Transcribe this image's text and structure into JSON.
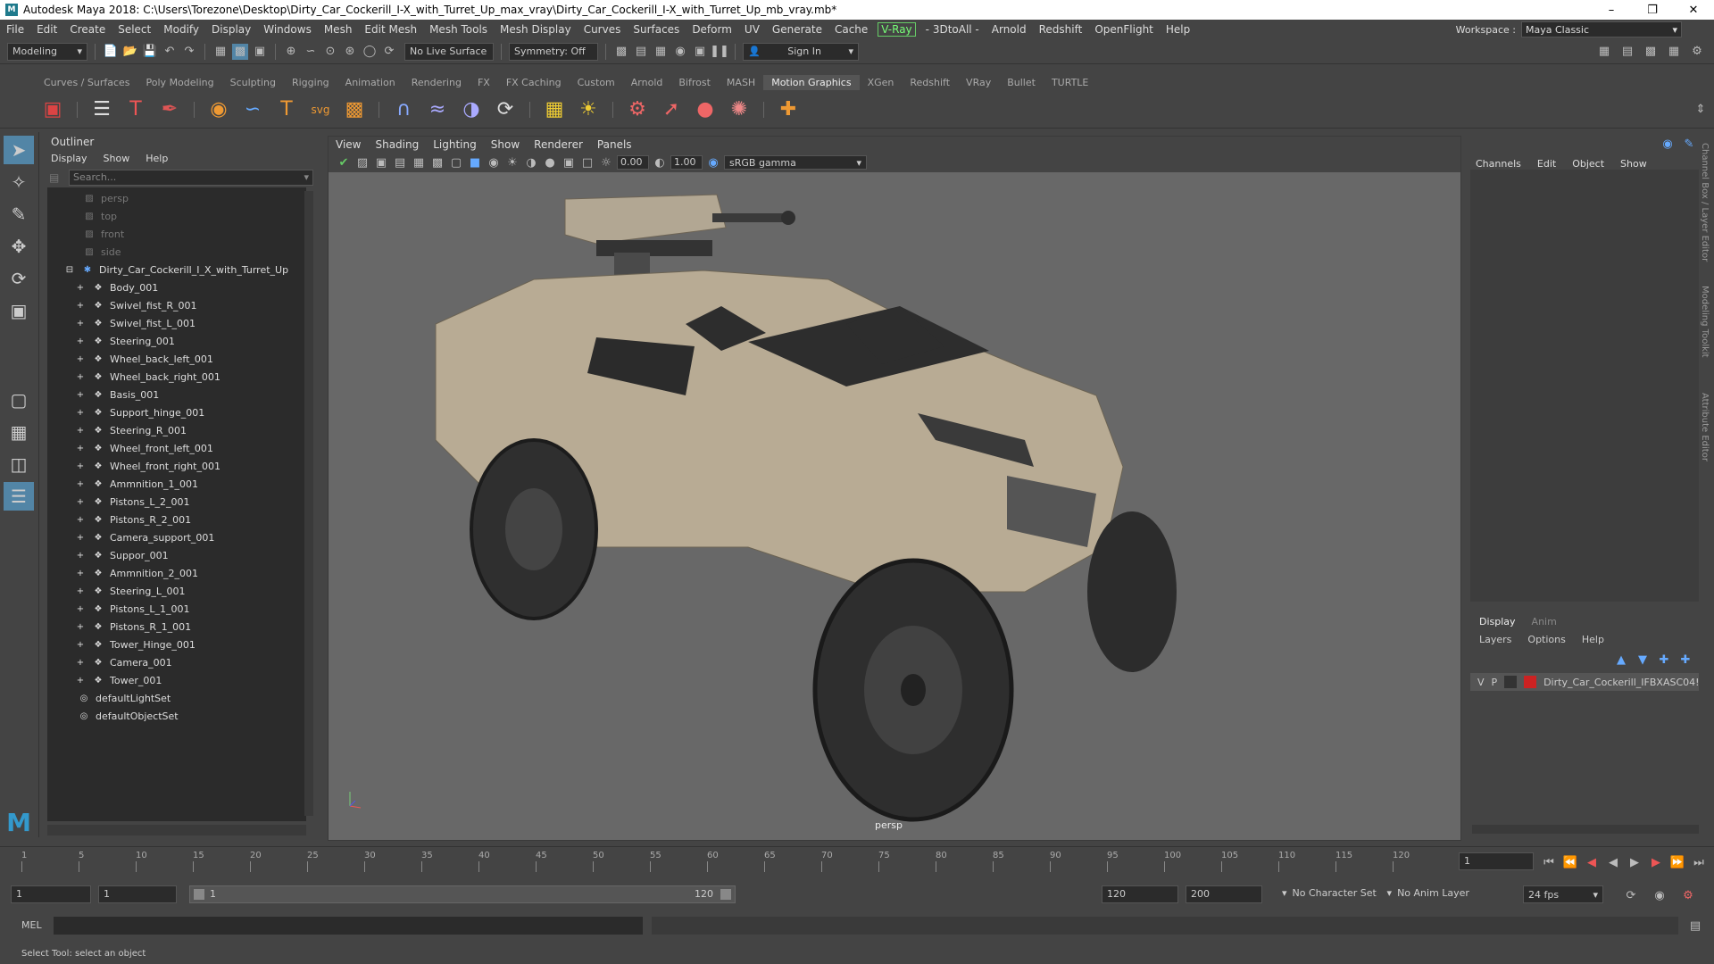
{
  "title": "Autodesk Maya 2018: C:\\Users\\Torezone\\Desktop\\Dirty_Car_Cockerill_I-X_with_Turret_Up_max_vray\\Dirty_Car_Cockerill_I-X_with_Turret_Up_mb_vray.mb*",
  "menu": [
    "File",
    "Edit",
    "Create",
    "Select",
    "Modify",
    "Display",
    "Windows",
    "Mesh",
    "Edit Mesh",
    "Mesh Tools",
    "Mesh Display",
    "Curves",
    "Surfaces",
    "Deform",
    "UV",
    "Generate",
    "Cache"
  ],
  "menu2": [
    "- 3DtoAll -",
    "Arnold",
    "Redshift",
    "OpenFlight",
    "Help"
  ],
  "vray": "V-Ray",
  "workspace": {
    "label": "Workspace :",
    "value": "Maya Classic"
  },
  "status": {
    "mode": "Modeling",
    "live": "No Live Surface",
    "symmetry": "Symmetry: Off",
    "signin": "Sign In"
  },
  "shelf_tabs": [
    "Curves / Surfaces",
    "Poly Modeling",
    "Sculpting",
    "Rigging",
    "Animation",
    "Rendering",
    "FX",
    "FX Caching",
    "Custom",
    "Arnold",
    "Bifrost",
    "MASH",
    "Motion Graphics",
    "XGen",
    "Redshift",
    "VRay",
    "Bullet",
    "TURTLE"
  ],
  "shelf_active": "Motion Graphics",
  "outliner": {
    "title": "Outliner",
    "menu": [
      "Display",
      "Show",
      "Help"
    ],
    "search": "Search...",
    "cameras": [
      "persp",
      "top",
      "front",
      "side"
    ],
    "root": "Dirty_Car_Cockerill_I_X_with_Turret_Up",
    "children": [
      "Body_001",
      "Swivel_fist_R_001",
      "Swivel_fist_L_001",
      "Steering_001",
      "Wheel_back_left_001",
      "Wheel_back_right_001",
      "Basis_001",
      "Support_hinge_001",
      "Steering_R_001",
      "Wheel_front_left_001",
      "Wheel_front_right_001",
      "Ammnition_1_001",
      "Pistons_L_2_001",
      "Pistons_R_2_001",
      "Camera_support_001",
      "Suppor_001",
      "Ammnition_2_001",
      "Steering_L_001",
      "Pistons_L_1_001",
      "Pistons_R_1_001",
      "Tower_Hinge_001",
      "Camera_001",
      "Tower_001"
    ],
    "sets": [
      "defaultLightSet",
      "defaultObjectSet"
    ]
  },
  "viewport": {
    "menu": [
      "View",
      "Shading",
      "Lighting",
      "Show",
      "Renderer",
      "Panels"
    ],
    "exposure": "0.00",
    "gamma": "1.00",
    "colorspace": "sRGB gamma",
    "camera": "persp"
  },
  "channelbox": {
    "tabs": [
      "Channels",
      "Edit",
      "Object",
      "Show"
    ]
  },
  "layers": {
    "tabs": [
      "Display",
      "Anim"
    ],
    "menu": [
      "Layers",
      "Options",
      "Help"
    ],
    "row": {
      "v": "V",
      "p": "P",
      "name": "Dirty_Car_Cockerill_IFBXASC04!"
    }
  },
  "side_tabs": [
    "Channel Box / Layer Editor",
    "Modeling Toolkit",
    "Attribute Editor"
  ],
  "timeline": {
    "ticks": [
      "1",
      "5",
      "10",
      "15",
      "20",
      "25",
      "30",
      "35",
      "40",
      "45",
      "50",
      "55",
      "60",
      "65",
      "70",
      "75",
      "80",
      "85",
      "90",
      "95",
      "100",
      "105",
      "110",
      "115",
      "120"
    ],
    "current": "1"
  },
  "range": {
    "start": "1",
    "start2": "1",
    "slider_start": "1",
    "slider_end": "120",
    "end": "120",
    "end2": "200",
    "charset": "No Character Set",
    "animlayer": "No Anim Layer",
    "fps": "24 fps"
  },
  "mel": "MEL",
  "help": "Select Tool: select an object"
}
